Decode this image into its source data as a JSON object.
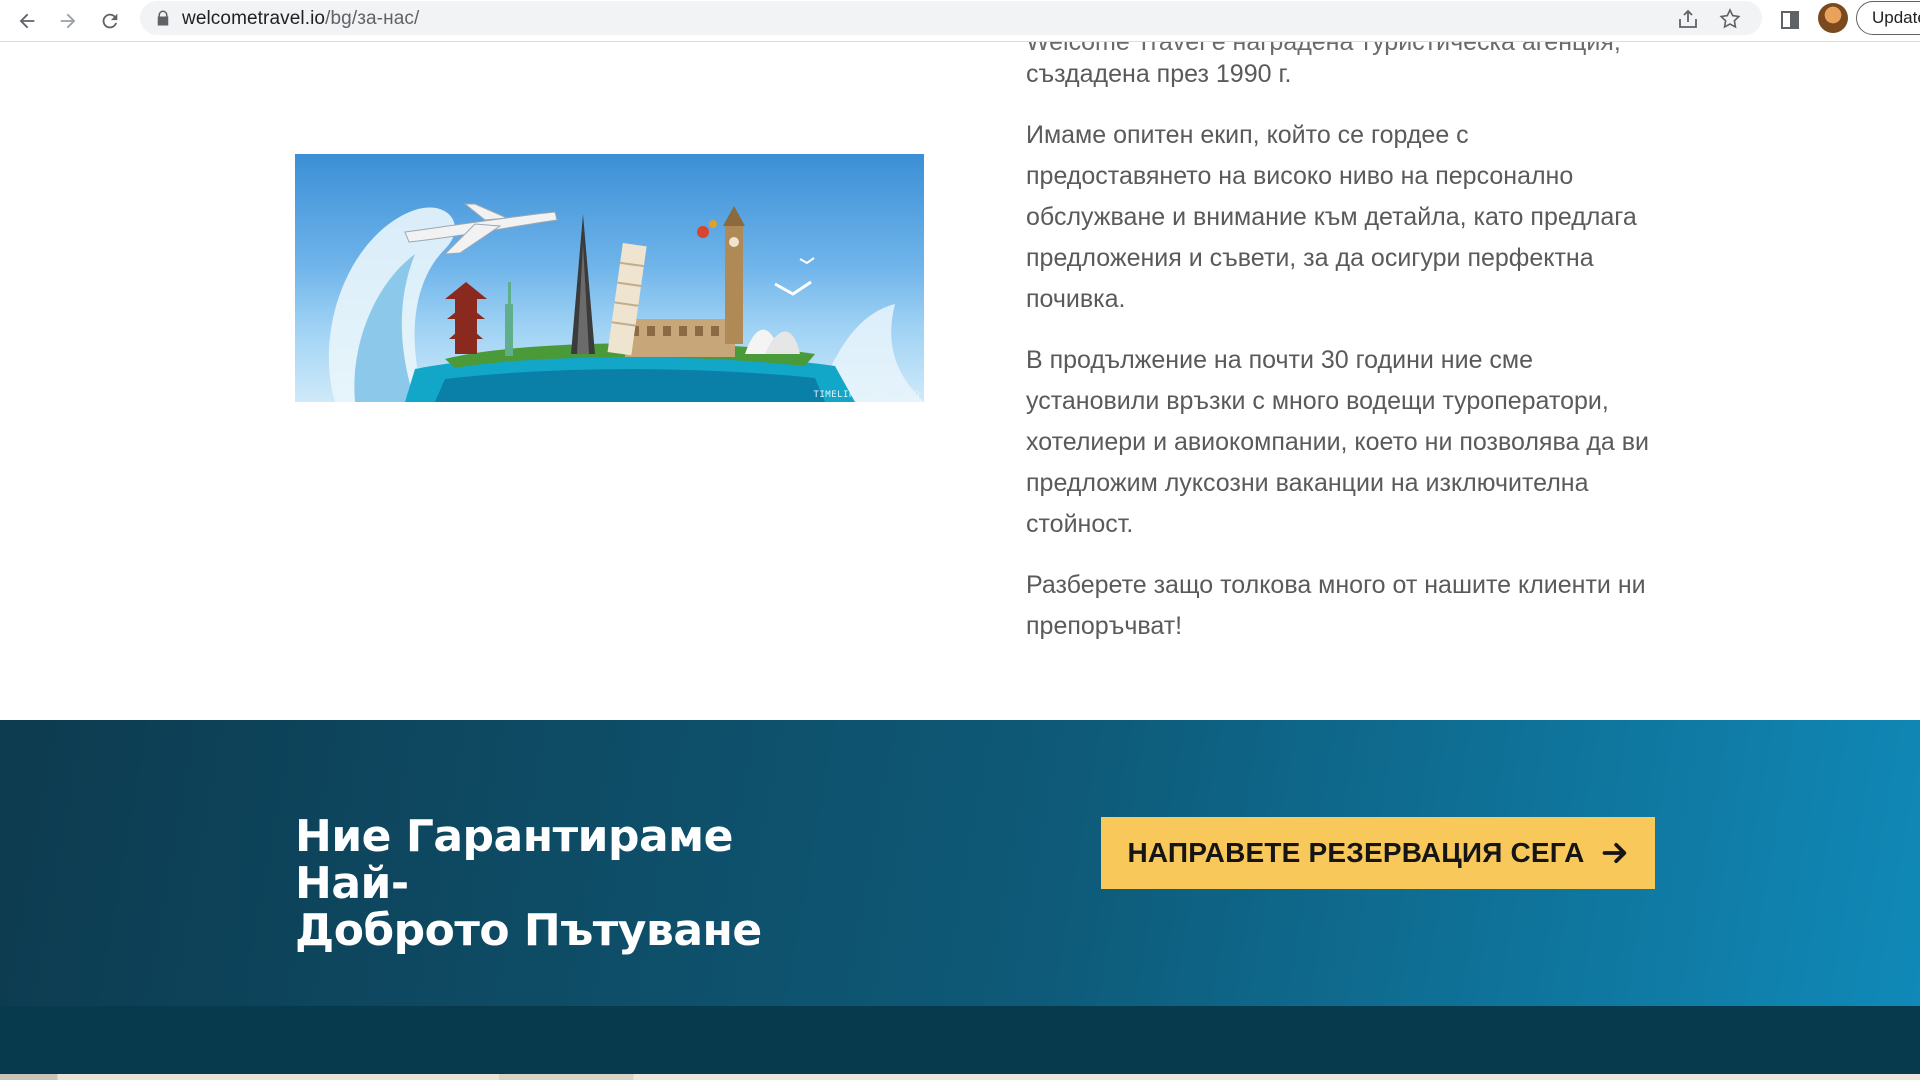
{
  "browser": {
    "url_domain": "welcometravel.io",
    "url_path": "/bg/за-нас/",
    "update_label": "Update"
  },
  "about": {
    "partial_top_line": "Welcome Travel е наградена туристическа агенция,",
    "founded_line": "създадена през 1990 г.",
    "paragraph2_lines": [
      "Имаме опитен екип, който се гордее с",
      "предоставянето на високо ниво на персонално",
      "обслужване и внимание към детайла, като предлага",
      "предложения и съвети, за да осигури перфектна",
      "почивка."
    ],
    "paragraph3_lines": [
      "В продължение на почти 30 години ние сме",
      "установили връзки с много водещи туроператори,",
      "хотелиери и авиокомпании, което ни позволява да ви",
      "предложим луксозни ваканции на изключителна",
      "стойност."
    ],
    "paragraph4_lines": [
      "Разберете защо толкова много от нашите клиенти ни",
      "препоръчват!"
    ],
    "image_watermark": "TIMELINECOVERS.PRO"
  },
  "cta": {
    "heading_line1": "Ние Гарантираме Най-",
    "heading_line2": "Доброто Пътуване",
    "button_label": "НАПРАВЕТЕ РЕЗЕРВАЦИЯ СЕГА"
  },
  "colors": {
    "cta_button_bg": "#f9c85a",
    "cta_band_dark": "#0d3b4f",
    "cta_band_light": "#1089b8",
    "footer_bg": "#083a4d",
    "body_text": "#5a5a5a"
  }
}
